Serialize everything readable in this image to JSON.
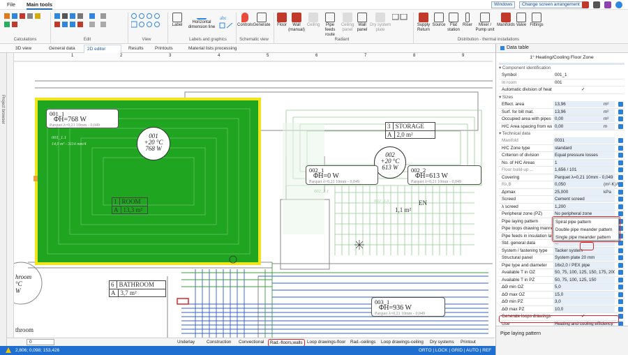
{
  "menubar": {
    "tabs": [
      "File",
      "Main tools"
    ],
    "windows_label": "Windows",
    "screen_arrangement": "Change screen arrangement"
  },
  "ribbon": {
    "groups": [
      "Calculations",
      "Edit",
      "View",
      "Labels and graphics",
      "Schematic view",
      "Radiant",
      "Distribution - thermal installations"
    ],
    "buttons": {
      "label": "Label",
      "horizontal_dimension_line": "Horizontal dimension line",
      "controls": "Controls",
      "generate": "Generate",
      "floor": "Floor",
      "wall_manual": "Wall (manual)",
      "ceiling": "Ceiling",
      "pipe_feeds_route": "Pipe feeds route",
      "ceiling_panel": "Ceiling panel",
      "wall_panel": "Wall panel",
      "dry_system_plate": "Dry system plate",
      "supply_return": "Supply Return",
      "source": "Source",
      "flat_station": "Flat station",
      "riser": "Riser",
      "mixer_pump_unit": "Mixer / Pump unit",
      "manifolds": "Manifolds",
      "valve": "Valve",
      "fittings": "Fittings"
    }
  },
  "doc_tabs": [
    "3D view",
    "General data",
    "2D editor",
    "Results",
    "Printouts",
    "Material lists processing"
  ],
  "left_strip_label": "Project browser",
  "canvas": {
    "ruler_numbers": [
      "1",
      "2",
      "3",
      "4",
      "5",
      "6",
      "7",
      "8",
      "9"
    ],
    "zone_001_1": {
      "name": "001_1",
      "heat": "ΦH=768 W",
      "parquet": "Parquet λ=0,21 10mm - 0,049"
    },
    "zone_001_circle": [
      "001",
      "+20 °C",
      "768 W"
    ],
    "room_1": {
      "num": "1",
      "name": "ROOM",
      "area_label": "A",
      "area": "13,3 m²"
    },
    "room_3": {
      "num": "3",
      "name": "STORAGE",
      "area_label": "A",
      "area": "2,0 m²"
    },
    "zone_002_circle": [
      "002",
      "+20 °C",
      "613 W"
    ],
    "zone_002_1": {
      "name": "002_1",
      "heat": "ΦH=0 W",
      "parquet": "Parquet λ=0,21 10mm - 0,049"
    },
    "zone_002_2": {
      "name": "002_2",
      "heat": "ΦH=613 W",
      "parquet": "Parquet λ=0,21 10mm - 0,049"
    },
    "room_6": {
      "num": "6",
      "name": "BATHROOM",
      "area_label": "A",
      "area": "3,7 m²"
    },
    "zone_003_1": {
      "name": "003_1",
      "heat": "ΦH=936 W",
      "parquet": "Parquet λ=0,21 10mm - 0,049"
    },
    "room_left_partial": [
      "hroom",
      "°C",
      "W"
    ],
    "room_left_bottom": "throom",
    "ghost_small_1": "002_2.1",
    "ghost_small_2": "002_2.3",
    "ghost_small_3": "1,1 m²",
    "room_en": "EN",
    "room_en_area": "1,1 m²",
    "ghost_pipes_left": "001_1.1",
    "ghost_pipes_left_sub": "14,0 m² - 3114 mm/4"
  },
  "layers": [
    {
      "label": "Underlay",
      "selected": false
    },
    {
      "label": "Construction",
      "selected": false
    },
    {
      "label": "Convectional",
      "selected": false
    },
    {
      "label": "Rad.-floors,walls",
      "selected": true
    },
    {
      "label": "Loop drawings-floor",
      "selected": false
    },
    {
      "label": "Rad.-ceilings",
      "selected": false
    },
    {
      "label": "Loop drawings-ceiling",
      "selected": false
    },
    {
      "label": "Dry systems",
      "selected": false
    },
    {
      "label": "Printout",
      "selected": false
    }
  ],
  "bottom_level": "0",
  "status": {
    "coords": "2,806; 0,098; 153,426",
    "modes": "ORTO | LOCK | GRID | AUTO | REF"
  },
  "panel": {
    "title": "Data table",
    "subtitle": "1° Heating/Cooling Floor Zone",
    "sections": {
      "component_identification": "Component identification",
      "sizes": "Sizes",
      "technical_data": "Technical data"
    },
    "rows_identification": [
      {
        "k": "Symbol",
        "v": "001_1"
      },
      {
        "k": "In room",
        "v": "001"
      },
      {
        "k": "Automatic division of heating ...",
        "v": "✓"
      }
    ],
    "rows_sizes": [
      {
        "k": "Effect. area",
        "v": "13,96",
        "u": "m²"
      },
      {
        "k": "Surf. for bill mat.",
        "v": "13,96",
        "u": "m²"
      },
      {
        "k": "Occupied area with pipes",
        "v": "0,00",
        "u": "m²"
      },
      {
        "k": "H/C Area spacing from wall",
        "v": "0,00",
        "u": "m"
      }
    ],
    "rows_technical": [
      {
        "k": "Manifold",
        "v": "0031"
      },
      {
        "k": "H/C Zone type",
        "v": "standard"
      },
      {
        "k": "Criterion of division",
        "v": "Equal pressure losses"
      },
      {
        "k": "No. of H/C Areas",
        "v": "1"
      },
      {
        "k": "Floor build-up ...",
        "v": "1,656 / 101"
      },
      {
        "k": "Covering",
        "v": "Parquet λ=0,21 10mm - 0,049"
      },
      {
        "k": "Rλ,B",
        "v": "0,050",
        "u": "(m²·K)/W"
      },
      {
        "k": "Δpmax",
        "v": "25,000",
        "u": "kPa"
      },
      {
        "k": "Screed",
        "v": "Cement screed"
      },
      {
        "k": "λ screed",
        "v": "1,200"
      },
      {
        "k": "Peripheral zone (PZ)",
        "v": "No peripheral zone"
      },
      {
        "k": "Pipe laying pattern",
        "v": "Spiral pipe pattern"
      },
      {
        "k": "Pipe loops drawing manner",
        "v": "Double pipe meander pattern"
      },
      {
        "k": "Pipe feeds in insulation layer",
        "v": "Single pipe meander pattern"
      },
      {
        "k": "Std. general data",
        "v": "..."
      },
      {
        "k": "System / fastening type",
        "v": "Tacker system"
      },
      {
        "k": "Structural panel",
        "v": "System plate 20 mm"
      },
      {
        "k": "Pipe type and diameter",
        "v": "16x2,0 / PEX pipe"
      },
      {
        "k": "Available T in OZ",
        "v": "50, 75, 100, 125, 150, 175, 200"
      },
      {
        "k": "Available T in PZ",
        "v": "50, 75, 100, 125, 150"
      },
      {
        "k": "ΔΘ min OZ",
        "v": "5,0"
      },
      {
        "k": "ΔΘ max OZ",
        "v": "15,0"
      },
      {
        "k": "ΔΘ min PZ",
        "v": "3,0"
      },
      {
        "k": "ΔΘ max PZ",
        "v": "10,0"
      },
      {
        "k": "Generate loops drawings",
        "v": "✓"
      },
      {
        "k": "Use",
        "v": "Heating and cooling efficiency"
      }
    ],
    "dropdown_options": [
      "Spiral pipe pattern",
      "Double pipe meander pattern",
      "Single pipe meander pattern"
    ],
    "footer_title": "Pipe laying pattern"
  },
  "colors": {
    "green_zone": "#1fa51f",
    "yellow_outline": "#f2e41a",
    "pipe_green": "#3d9b3d",
    "blue_pipes": "#2e5cd6",
    "status_blue": "#1f6fd1",
    "highlight_red": "#d9262b"
  }
}
